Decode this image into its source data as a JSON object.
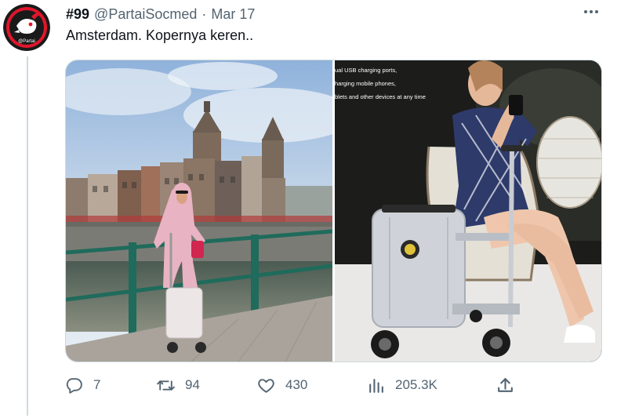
{
  "author": {
    "display_name": "#99",
    "handle": "@PartaiSocmed",
    "separator": "·",
    "date": "Mar 17",
    "avatar_label": "@Partai"
  },
  "tweet": {
    "text": "Amsterdam. Kopernya keren.."
  },
  "media": {
    "right_photo_caption": [
      "ual USB charging ports,",
      "harging mobile phones,",
      "blets and other devices at any time"
    ]
  },
  "actions": {
    "replies": "7",
    "retweets": "94",
    "likes": "430",
    "views": "205.3K"
  },
  "colors": {
    "text_primary": "#0f1419",
    "text_secondary": "#536471",
    "border": "#cfd9de",
    "avatar_red": "#e0162b"
  },
  "icons": [
    "more-icon",
    "reply-icon",
    "retweet-icon",
    "like-icon",
    "views-icon",
    "share-icon"
  ]
}
